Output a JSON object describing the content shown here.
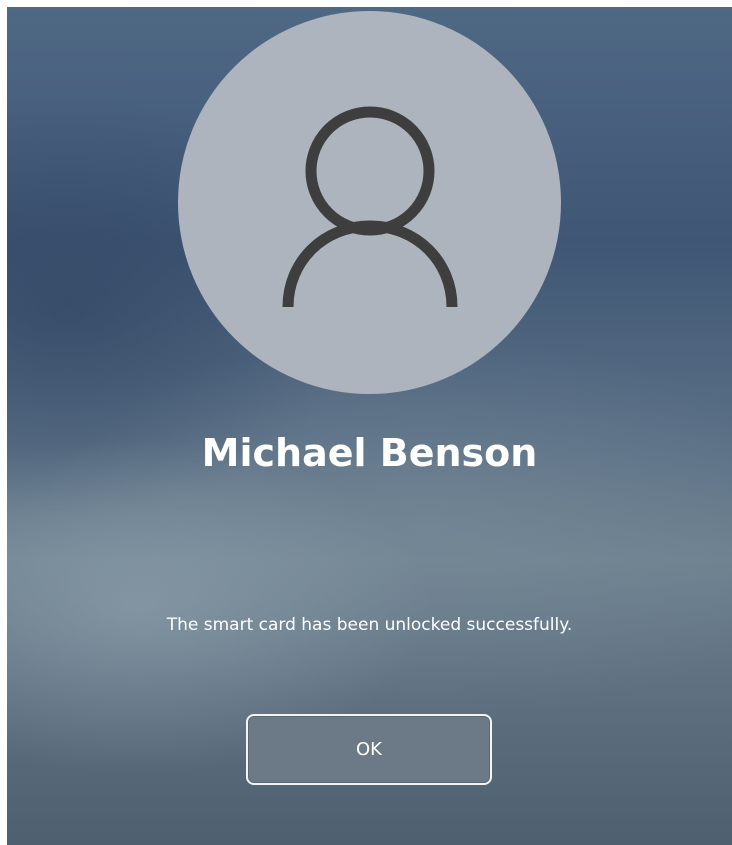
{
  "user": {
    "name": "Michael Benson",
    "avatar_icon": "person-icon"
  },
  "dialog": {
    "message": "The smart card has been unlocked successfully.",
    "ok_label": "OK"
  },
  "colors": {
    "avatar_background": "#adb4bd",
    "avatar_glyph": "#3e3e3e",
    "button_background": "#6c7a87",
    "button_border": "#f2f4f6",
    "text": "#ffffff"
  }
}
